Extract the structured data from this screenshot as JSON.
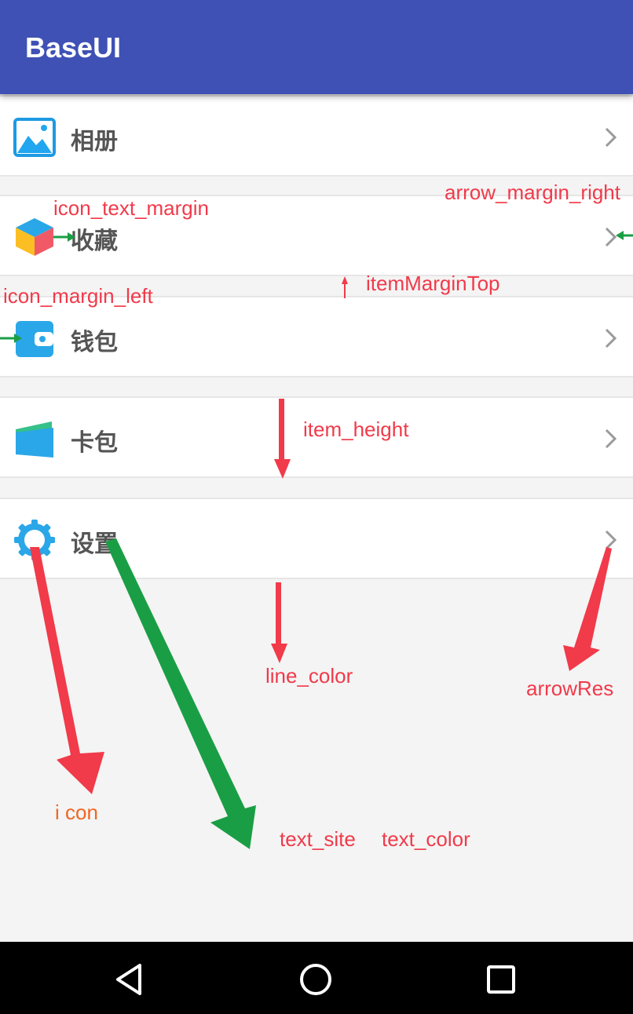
{
  "app": {
    "title": "BaseUI"
  },
  "items": [
    {
      "label": "相册",
      "icon": "photo-album-icon"
    },
    {
      "label": "收藏",
      "icon": "favorites-cube-icon"
    },
    {
      "label": "钱包",
      "icon": "wallet-icon"
    },
    {
      "label": "卡包",
      "icon": "card-pack-icon"
    },
    {
      "label": "设置",
      "icon": "settings-gear-icon"
    }
  ],
  "annotations": {
    "icon_text_margin": "icon_text_margin",
    "arrow_margin_right": "arrow_margin_right",
    "item_margin_top": "itemMarginTop",
    "icon_margin_left": "icon_margin_left",
    "item_height": "item_height",
    "line_color": "line_color",
    "arrow_res": "arrowRes",
    "icon": "i con",
    "text_site": "text_site",
    "text_color": "text_color"
  },
  "colors": {
    "appbar": "#3f51b5",
    "annotation_red": "#f13a4a",
    "annotation_green": "#1a9e45",
    "annotation_orange": "#f26522"
  },
  "navbar": {
    "back": "back-triangle-icon",
    "home": "home-circle-icon",
    "recents": "recents-square-icon"
  }
}
